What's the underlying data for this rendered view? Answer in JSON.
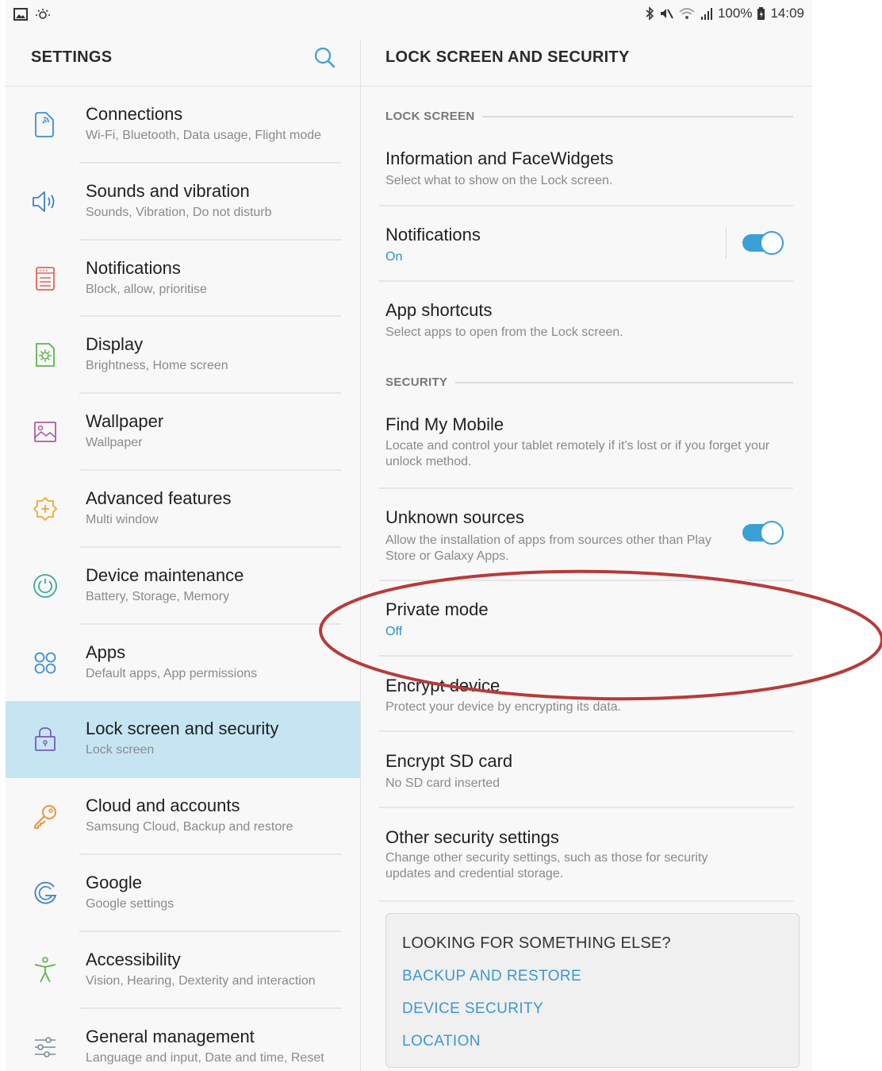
{
  "status_bar": {
    "battery": "100%",
    "time": "14:09"
  },
  "left_panel": {
    "title": "SETTINGS",
    "search_icon": "search-icon",
    "items": [
      {
        "title": "Connections",
        "subtitle": "Wi-Fi, Bluetooth, Data usage, Flight mode",
        "icon": "connections-icon",
        "color": "#3a8fd0"
      },
      {
        "title": "Sounds and vibration",
        "subtitle": "Sounds, Vibration, Do not disturb",
        "icon": "speaker-icon",
        "color": "#3a7fd0"
      },
      {
        "title": "Notifications",
        "subtitle": "Block, allow, prioritise",
        "icon": "notifications-icon",
        "color": "#e8645a"
      },
      {
        "title": "Display",
        "subtitle": "Brightness, Home screen",
        "icon": "display-icon",
        "color": "#5ab54a"
      },
      {
        "title": "Wallpaper",
        "subtitle": "Wallpaper",
        "icon": "wallpaper-icon",
        "color": "#b05aa0"
      },
      {
        "title": "Advanced features",
        "subtitle": "Multi window",
        "icon": "advanced-icon",
        "color": "#f0a830"
      },
      {
        "title": "Device maintenance",
        "subtitle": "Battery, Storage, Memory",
        "icon": "maintenance-icon",
        "color": "#3aaa9a"
      },
      {
        "title": "Apps",
        "subtitle": "Default apps, App permissions",
        "icon": "apps-icon",
        "color": "#3a8fd0"
      },
      {
        "title": "Lock screen and security",
        "subtitle": "Lock screen",
        "icon": "lock-icon",
        "color": "#7b5ab8",
        "active": true
      },
      {
        "title": "Cloud and accounts",
        "subtitle": "Samsung Cloud, Backup and restore",
        "icon": "key-icon",
        "color": "#f08a30"
      },
      {
        "title": "Google",
        "subtitle": "Google settings",
        "icon": "google-icon",
        "color": "#3a7fd0"
      },
      {
        "title": "Accessibility",
        "subtitle": "Vision, Hearing, Dexterity and interaction",
        "icon": "accessibility-icon",
        "color": "#5ab54a"
      },
      {
        "title": "General management",
        "subtitle": "Language and input, Date and time, Reset",
        "icon": "sliders-icon",
        "color": "#7a8a9a"
      }
    ]
  },
  "right_panel": {
    "title": "LOCK SCREEN AND SECURITY",
    "section_lock": "LOCK SCREEN",
    "section_security": "SECURITY",
    "info_title": "Information and FaceWidgets",
    "info_sub": "Select what to show on the Lock screen.",
    "notif_title": "Notifications",
    "notif_sub": "On",
    "notif_toggle": true,
    "shortcuts_title": "App shortcuts",
    "shortcuts_sub": "Select apps to open from the Lock screen.",
    "findmy_title": "Find My Mobile",
    "findmy_sub": "Locate and control your tablet remotely if it's lost or if you forget your unlock method.",
    "unknown_title": "Unknown sources",
    "unknown_sub": "Allow the installation of apps from sources other than Play Store or Galaxy Apps.",
    "unknown_toggle": true,
    "private_title": "Private mode",
    "private_sub": "Off",
    "encrypt_title": "Encrypt device",
    "encrypt_sub": "Protect your device by encrypting its data.",
    "sd_title": "Encrypt SD card",
    "sd_sub": "No SD card inserted",
    "other_title": "Other security settings",
    "other_sub": "Change other security settings, such as those for security updates and credential storage.",
    "looking_title": "LOOKING FOR SOMETHING ELSE?",
    "looking_links": [
      "BACKUP AND RESTORE",
      "DEVICE SECURITY",
      "LOCATION"
    ]
  },
  "colors": {
    "accent": "#2d8fc9",
    "active_bg": "#c6e5f3",
    "annotation": "#b83a3a"
  }
}
